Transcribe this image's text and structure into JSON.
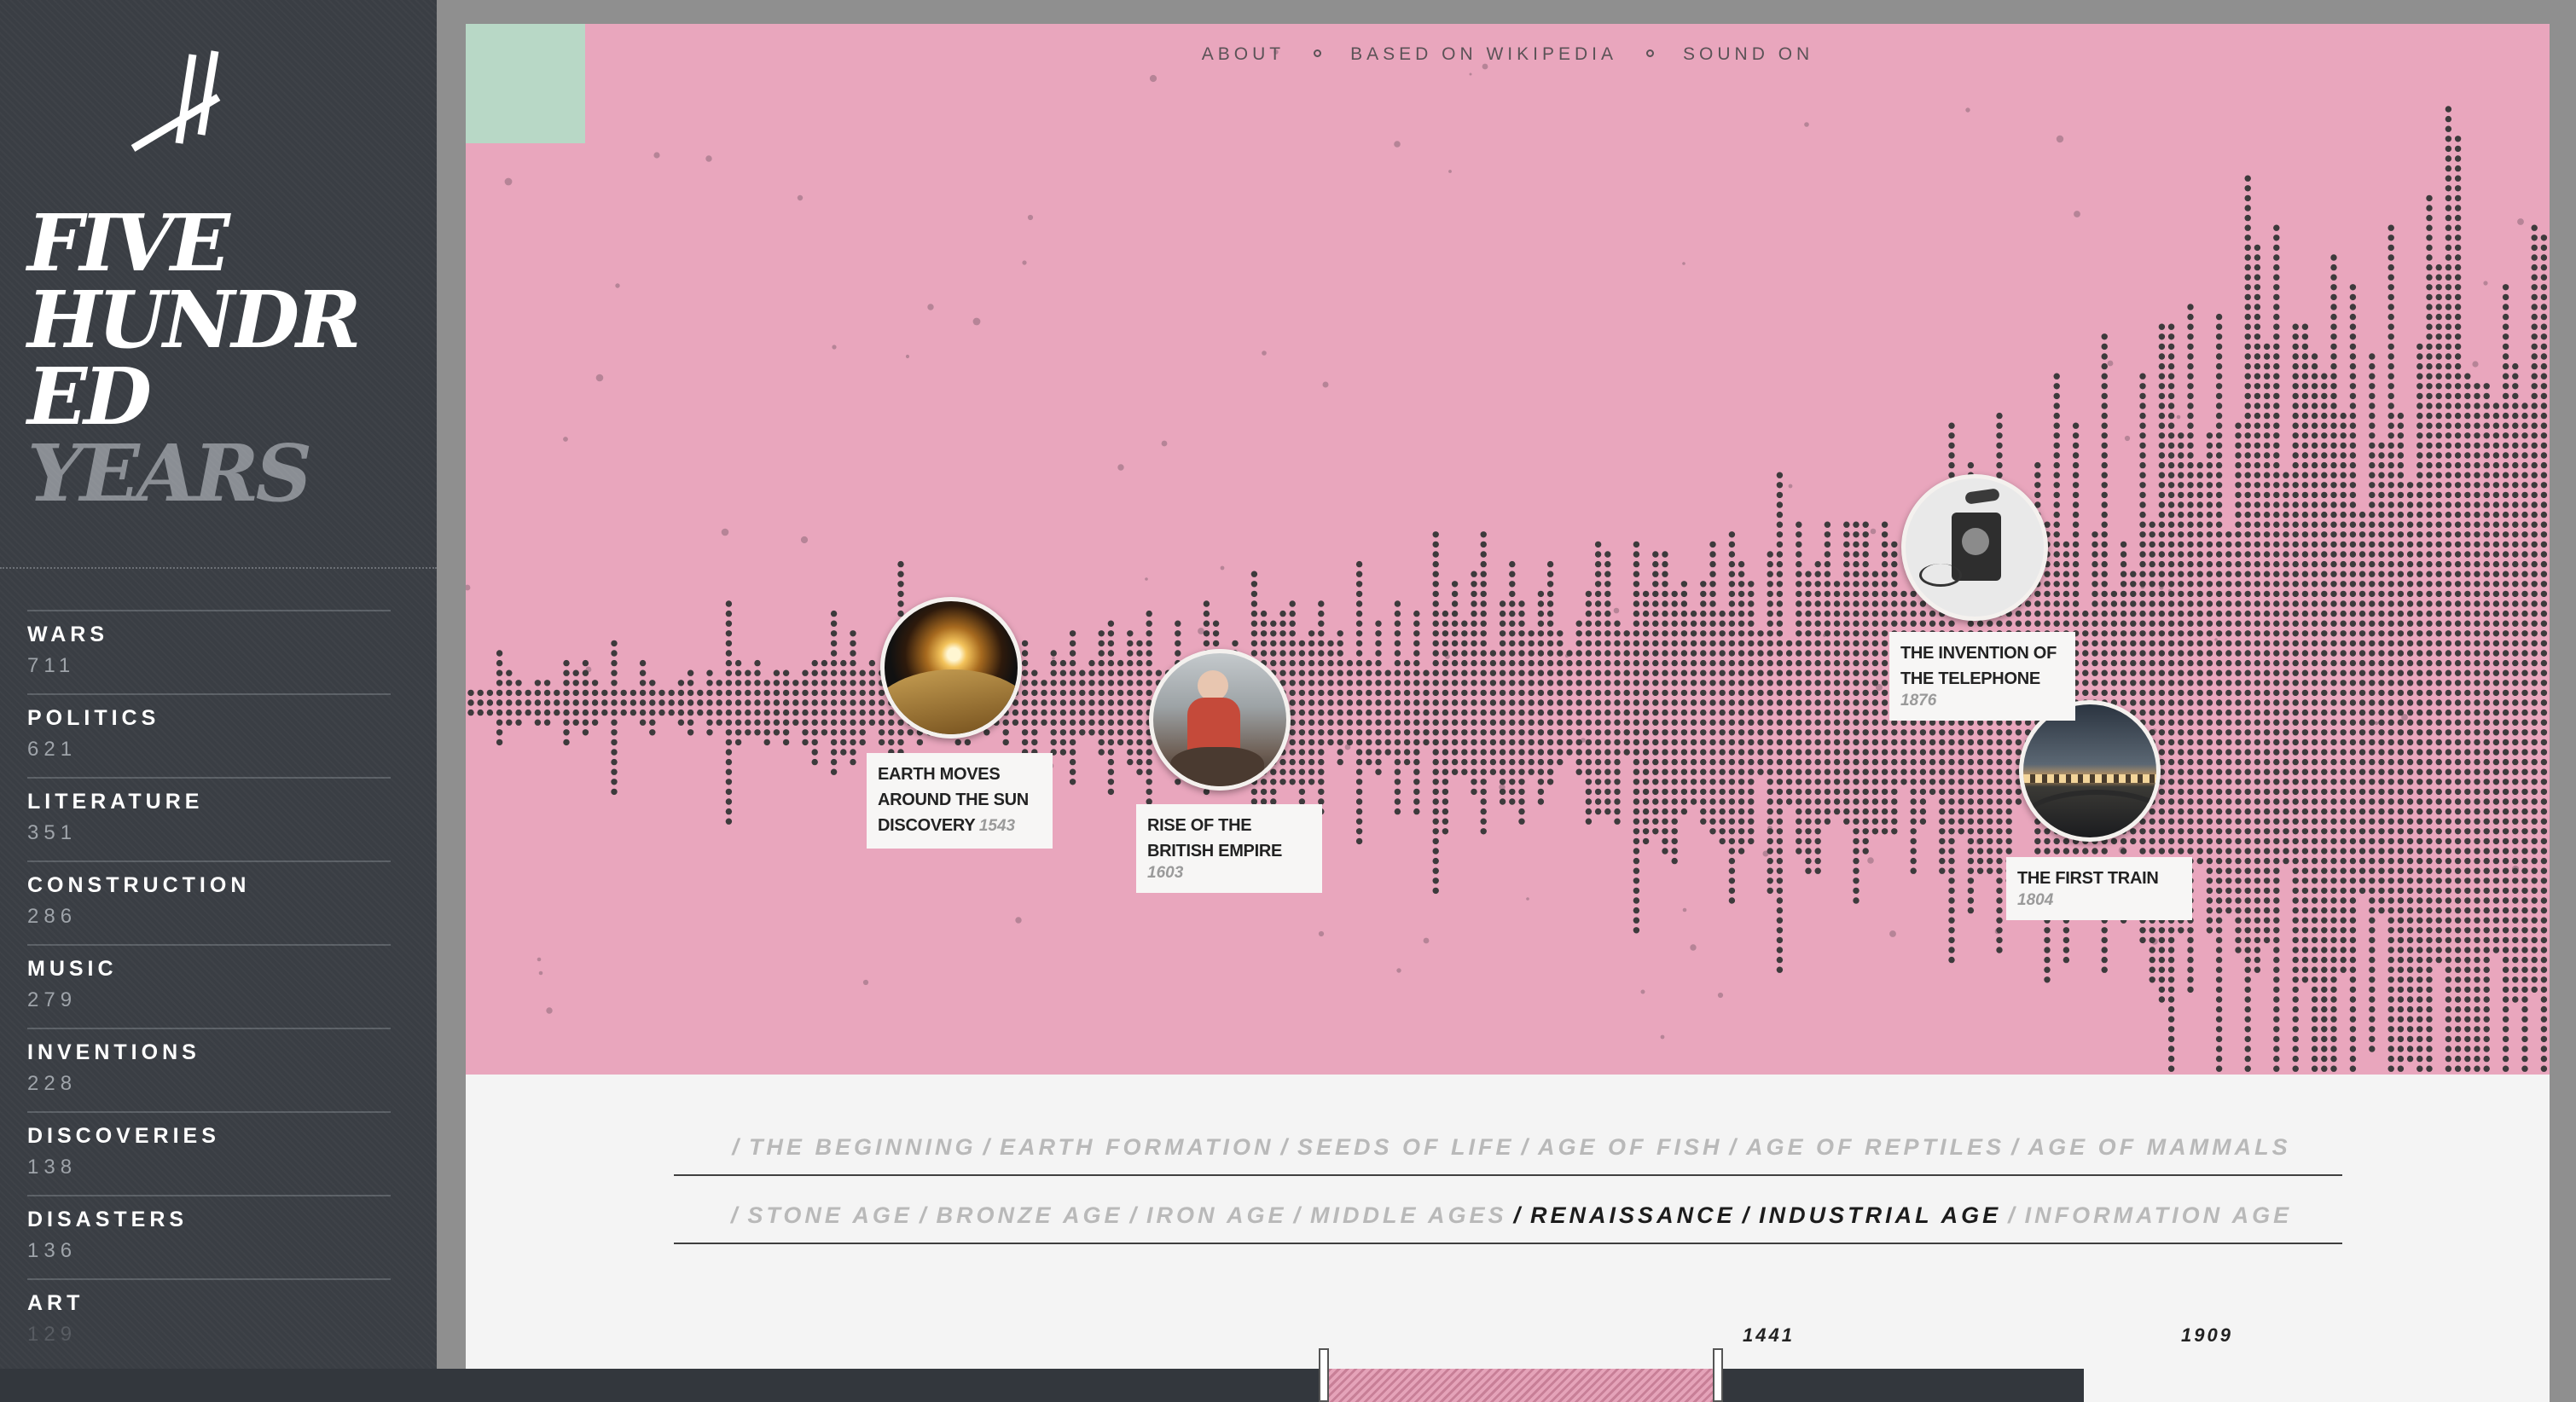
{
  "site": {
    "title_lines": [
      "FIVE",
      "HUNDR",
      "ED"
    ],
    "title_last": "YEARS"
  },
  "categories": [
    {
      "name": "WARS",
      "count": "711"
    },
    {
      "name": "POLITICS",
      "count": "621"
    },
    {
      "name": "LITERATURE",
      "count": "351"
    },
    {
      "name": "CONSTRUCTION",
      "count": "286"
    },
    {
      "name": "MUSIC",
      "count": "279"
    },
    {
      "name": "INVENTIONS",
      "count": "228"
    },
    {
      "name": "DISCOVERIES",
      "count": "138"
    },
    {
      "name": "DISASTERS",
      "count": "136"
    },
    {
      "name": "ART",
      "count": "129"
    }
  ],
  "nav": {
    "about": "ABOUT",
    "based": "BASED ON WIKIPEDIA",
    "sound": "SOUND ON"
  },
  "events": [
    {
      "title": "EARTH MOVES AROUND THE SUN DISCOVERY",
      "year": "1543"
    },
    {
      "title": "RISE OF THE BRITISH EMPIRE",
      "year": "1603"
    },
    {
      "title": "THE FIRST TRAIN",
      "year": "1804"
    },
    {
      "title": "THE INVENTION OF THE TELEPHONE",
      "year": "1876"
    }
  ],
  "eras": {
    "row1": [
      "THE BEGINNING",
      "EARTH FORMATION",
      "SEEDS OF LIFE",
      "AGE OF FISH",
      "AGE OF REPTILES",
      "AGE OF MAMMALS"
    ],
    "row2": [
      "STONE AGE",
      "BRONZE AGE",
      "IRON AGE",
      "MIDDLE AGES",
      "RENAISSANCE",
      "INDUSTRIAL AGE",
      "INFORMATION AGE"
    ],
    "active": [
      "RENAISSANCE",
      "INDUSTRIAL AGE"
    ]
  },
  "range": {
    "start": "1441",
    "end": "1909"
  },
  "colors": {
    "sidebar": "#3a3e44",
    "pink": "#e9a6bd",
    "mint": "#b8d8c6",
    "dot": "#3d3a3c",
    "eras_bg": "#f4f4f4"
  }
}
